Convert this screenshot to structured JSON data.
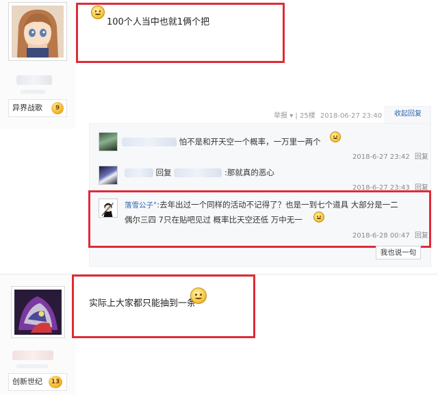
{
  "posts": [
    {
      "level_name": "异界战歌",
      "level_number": "9",
      "content": "100个人当中也就1俩个把",
      "meta": {
        "report": "举报",
        "floor": "25楼",
        "time": "2018-06-27 23:40",
        "collapse": "收起回复"
      }
    },
    {
      "level_name": "创新世纪",
      "level_number": "13",
      "content": "实际上大家都只能抽到一条"
    }
  ],
  "replies": [
    {
      "username": "",
      "text": "怕不是和开天空一个概率，一万里一两个",
      "time": "2018-6-27 23:42",
      "reply_label": "回复"
    },
    {
      "username": "",
      "prefix": "回复",
      "text": ":那就真的恶心",
      "time": "2018-6-27 23:43",
      "reply_label": "回复"
    },
    {
      "username": "落雪公子°",
      "text_line1": ":去年出过一个同样的活动不记得了？也是一到七个道具 大部分是一二",
      "text_line2": "偶尔三四 7只在贴吧见过 概率比天空还低 万中无一",
      "time": "2018-6-28 00:47",
      "reply_label": "回复"
    }
  ],
  "say_button": "我也说一句",
  "colors": {
    "highlight_border": "#e02a35",
    "link": "#2d64b3",
    "meta_text": "#999999"
  }
}
